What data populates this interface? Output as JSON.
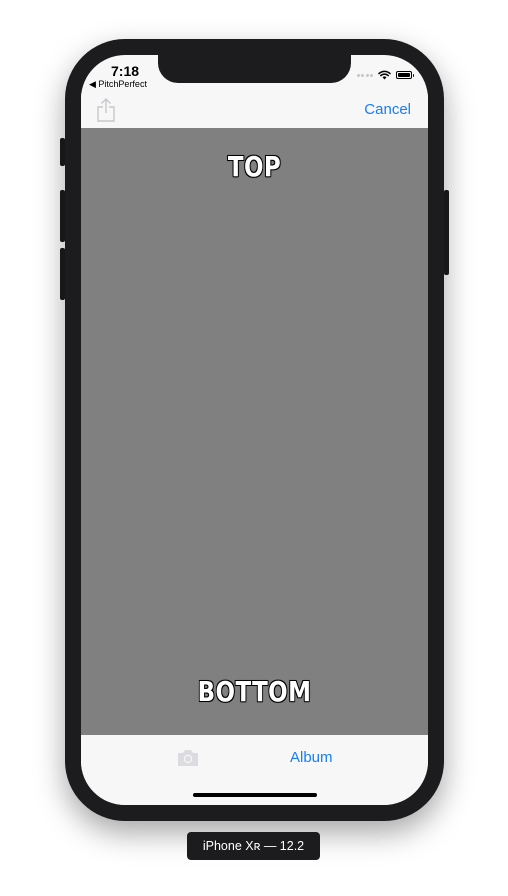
{
  "status_bar": {
    "time": "7:18",
    "back_app": "◀ PitchPerfect"
  },
  "nav_bar": {
    "share_icon": "share-icon",
    "cancel_label": "Cancel"
  },
  "meme": {
    "top_text": "TOP",
    "bottom_text": "BOTTOM",
    "background_color": "#808080"
  },
  "toolbar": {
    "camera_icon": "camera-icon",
    "album_label": "Album"
  },
  "simulator": {
    "device_label": "iPhone Xʀ — 12.2"
  },
  "colors": {
    "accent": "#147efb",
    "bar_background": "#f7f7f7",
    "disabled_icon": "#c7c7cc"
  }
}
